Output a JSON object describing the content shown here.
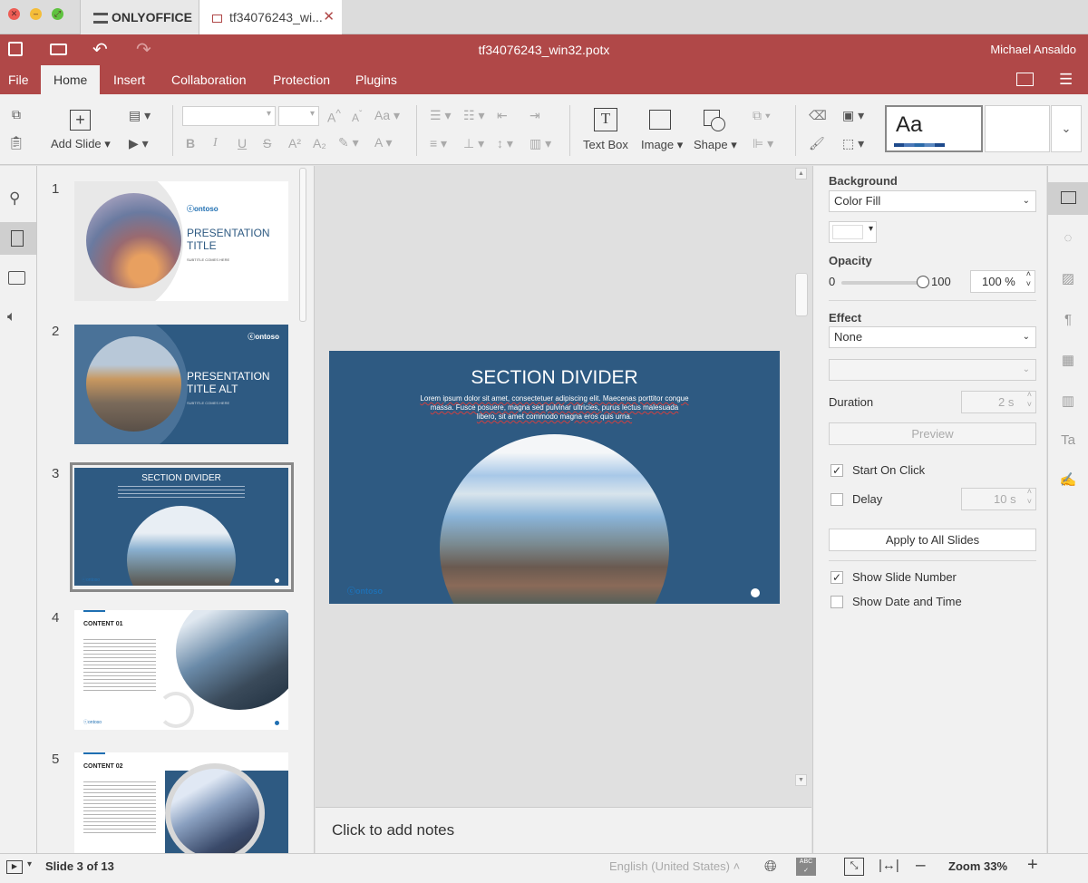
{
  "browser": {
    "tabs": [
      {
        "label": "ONLYOFFICE"
      },
      {
        "label": "tf34076243_wi..."
      }
    ]
  },
  "header": {
    "title": "tf34076243_win32.potx",
    "user": "Michael Ansaldo",
    "menu": [
      "File",
      "Home",
      "Insert",
      "Collaboration",
      "Protection",
      "Plugins"
    ]
  },
  "toolbar": {
    "add_slide": "Add Slide",
    "text_box": "Text Box",
    "image": "Image",
    "shape": "Shape",
    "theme_preview": "Aa",
    "font_grow": "A",
    "font_shrink": "A",
    "case": "Aa",
    "bold": "B",
    "italic": "I",
    "underline": "U",
    "strike": "S",
    "superscript": "A²",
    "subscript": "A₂"
  },
  "slides": [
    {
      "num": "1",
      "logo": "ontoso",
      "title_line1": "PRESENTATION",
      "title_line2": "TITLE",
      "subtitle": "SUBTITLE COMES HERE"
    },
    {
      "num": "2",
      "logo": "ontoso",
      "title_line1": "PRESENTATION",
      "title_line2": "TITLE ALT",
      "subtitle": "SUBTITLE COMES HERE"
    },
    {
      "num": "3",
      "title": "SECTION DIVIDER",
      "logo": "ontoso"
    },
    {
      "num": "4",
      "heading": "CONTENT 01",
      "logo": "ontoso"
    },
    {
      "num": "5",
      "heading": "CONTENT 02"
    }
  ],
  "main_slide": {
    "title": "SECTION DIVIDER",
    "body": "Lorem ipsum dolor sit amet, consectetuer adipiscing elit. Maecenas porttitor congue massa. Fusce posuere, magna sed pulvinar ultricies, purus lectus malesuada libero, sit amet commodo magna eros quis urna.",
    "logo": "ontoso"
  },
  "notes": {
    "placeholder": "Click to add notes"
  },
  "panel": {
    "background_label": "Background",
    "background_fill": "Color Fill",
    "opacity_label": "Opacity",
    "opacity_min": "0",
    "opacity_max": "100",
    "opacity_value": "100 %",
    "opacity_level": 1.0,
    "effect_label": "Effect",
    "effect_value": "None",
    "duration_label": "Duration",
    "duration_value": "2 s",
    "preview": "Preview",
    "start_on_click": "Start On Click",
    "delay_label": "Delay",
    "delay_value": "10 s",
    "apply_all": "Apply to All Slides",
    "show_slide_number": "Show Slide Number",
    "show_date_time": "Show Date and Time"
  },
  "status": {
    "slide_info": "Slide 3 of 13",
    "language": "English (United States)",
    "zoom": "Zoom 33%"
  },
  "colors": {
    "accent": "#b04848",
    "slide_blue": "#2e5a82",
    "logo_blue": "#1f6fb2"
  }
}
